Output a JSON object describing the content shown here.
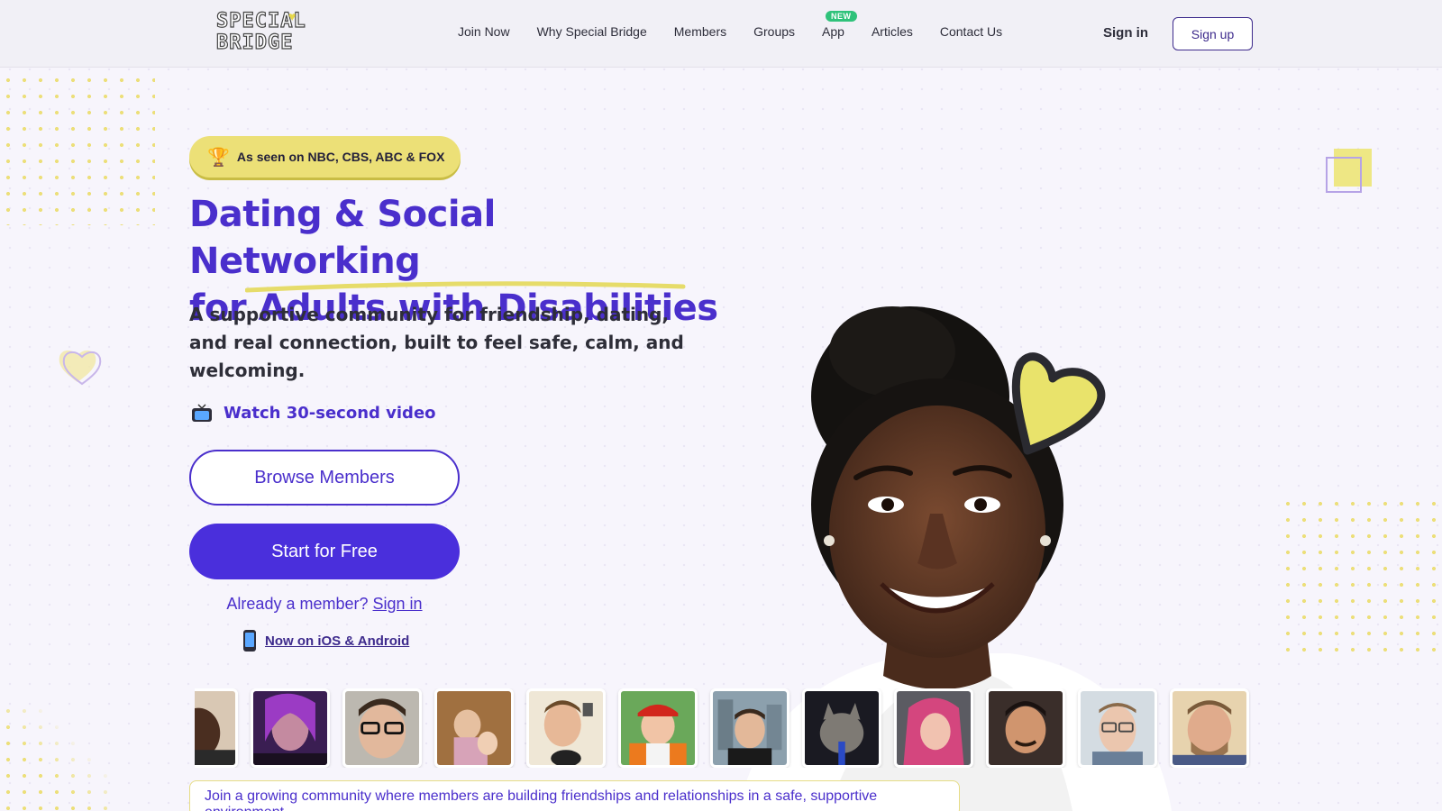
{
  "header": {
    "logo_text_line1": "SPECIAL",
    "logo_text_line2": "BRIDGE",
    "nav": [
      {
        "label": "Join Now"
      },
      {
        "label": "Why Special Bridge"
      },
      {
        "label": "Members"
      },
      {
        "label": "Groups"
      },
      {
        "label": "App",
        "badge": "NEW"
      },
      {
        "label": "Articles"
      },
      {
        "label": "Contact Us"
      }
    ],
    "sign_in": "Sign in",
    "sign_up": "Sign up"
  },
  "hero": {
    "badge": "As seen on NBC, CBS, ABC & FOX",
    "badge_icon": "trophy-icon",
    "title_line1": "Dating & Social Networking",
    "title_line2": "for Adults with Disabilities",
    "subtitle": "A supportive community for friendship, dating, and real connection, built to feel safe, calm, and welcoming.",
    "video_link": "Watch 30-second video",
    "video_icon": "tv-icon",
    "browse_button": "Browse Members",
    "start_button": "Start for Free",
    "already_member": "Already a member?",
    "already_sign_in": "Sign in",
    "mobile_text": "Now on iOS & Android",
    "mobile_icon": "phone-icon"
  },
  "members_strip_count": 12,
  "community_text": "Join a growing community where members are building friendships and relationships in a safe, supportive environment.",
  "colors": {
    "primary": "#4a2fdc",
    "accent_yellow": "#ece077",
    "background": "#f7f5fc"
  }
}
